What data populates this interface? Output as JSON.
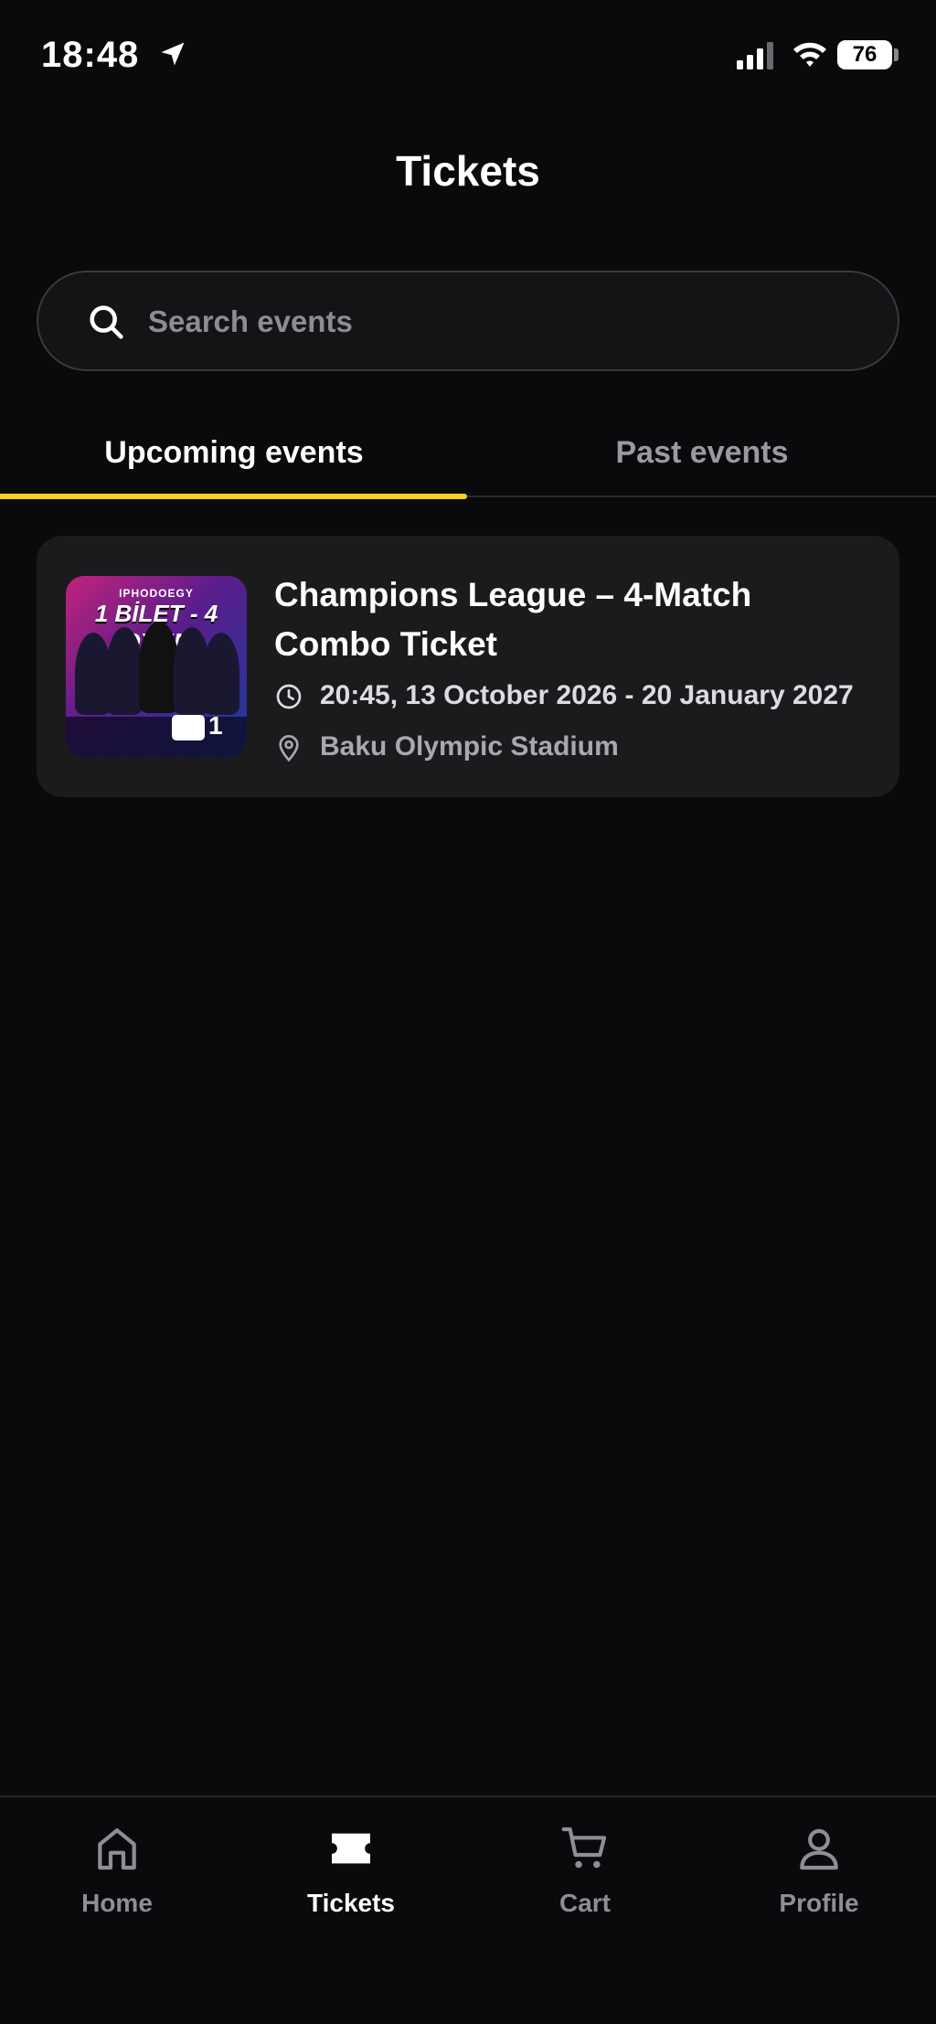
{
  "status_bar": {
    "time": "18:48",
    "battery": "76"
  },
  "header": {
    "title": "Tickets"
  },
  "search": {
    "placeholder": "Search events"
  },
  "tabs": [
    {
      "label": "Upcoming events",
      "active": true
    },
    {
      "label": "Past events",
      "active": false
    }
  ],
  "events": [
    {
      "title": "Champions League – 4-Match Combo Ticket",
      "datetime": "20:45, 13 October 2026 - 20 January 2027",
      "venue": "Baku Olympic Stadium",
      "thumbnail": {
        "brand": "IPHODOEGY",
        "headline": "1 BİLET - 4 OYUN",
        "ticket_count": "1"
      }
    }
  ],
  "bottom_nav": [
    {
      "label": "Home",
      "icon": "home-icon",
      "active": false
    },
    {
      "label": "Tickets",
      "icon": "ticket-icon",
      "active": true
    },
    {
      "label": "Cart",
      "icon": "cart-icon",
      "active": false
    },
    {
      "label": "Profile",
      "icon": "profile-icon",
      "active": false
    }
  ],
  "colors": {
    "background": "#0a0a0c",
    "card": "#1b1b1e",
    "accent": "#f5d21e",
    "muted_text": "#9a9aa0"
  }
}
